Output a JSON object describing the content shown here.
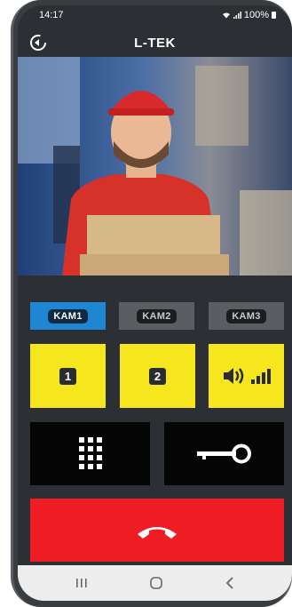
{
  "status": {
    "time": "14:17",
    "battery": "100%"
  },
  "app": {
    "logo": "L-TEK"
  },
  "video": {
    "subject": "delivery-person-feed"
  },
  "cameras": [
    {
      "label": "KAM1",
      "active": true
    },
    {
      "label": "KAM2",
      "active": false
    },
    {
      "label": "KAM3",
      "active": false
    }
  ],
  "actions": {
    "relay1": "1",
    "relay2": "2"
  },
  "icons": {
    "back": "back-icon",
    "volume": "volume-icon",
    "keypad": "keypad-icon",
    "key": "key-icon",
    "hangup": "hangup-icon"
  },
  "colors": {
    "accent_blue": "#1e86d3",
    "button_yellow": "#f5e61d",
    "hangup_red": "#ee1e24",
    "background": "#2c2f33"
  }
}
